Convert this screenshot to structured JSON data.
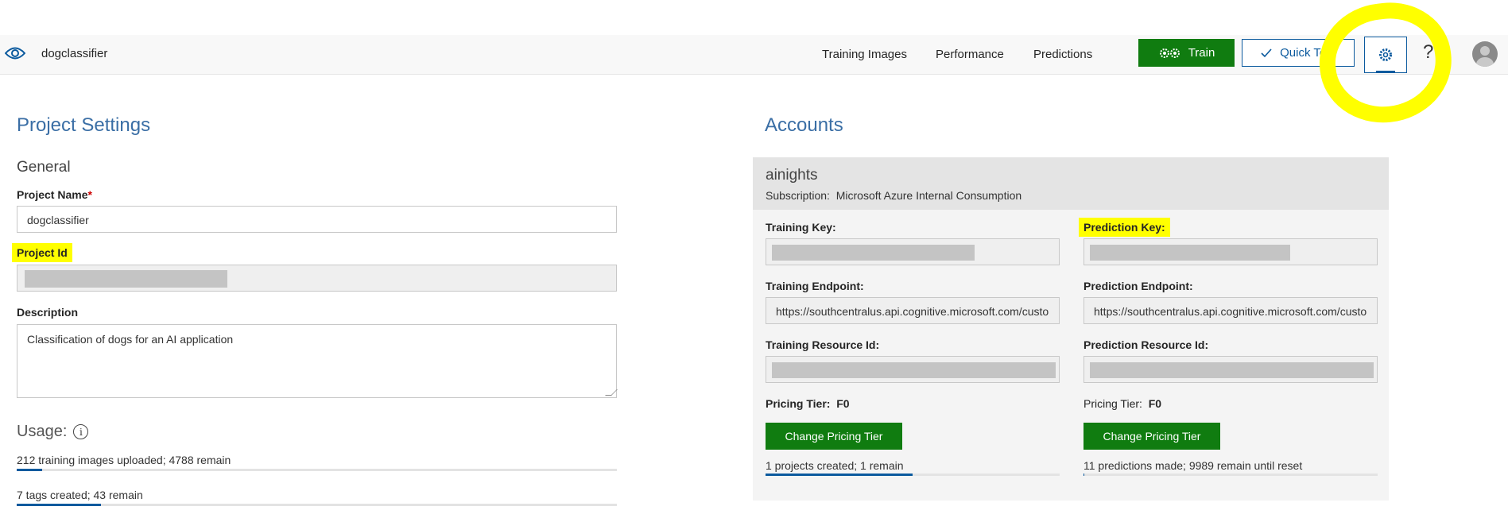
{
  "header": {
    "app_name": "dogclassifier",
    "nav": [
      "Training Images",
      "Performance",
      "Predictions"
    ],
    "train_label": "Train",
    "quick_test_label": "Quick Test",
    "help_glyph": "?"
  },
  "settings": {
    "title": "Project Settings",
    "general_title": "General",
    "project_name_label": "Project Name",
    "required_marker": "*",
    "project_name_value": "dogclassifier",
    "project_id_label": "Project Id",
    "description_label": "Description",
    "description_value": "Classification of dogs for an AI application",
    "usage_title": "Usage:",
    "usage": [
      {
        "text": "212 training images uploaded; 4788 remain",
        "progress": 0.042
      },
      {
        "text": "7 tags created; 43 remain",
        "progress": 0.14
      }
    ]
  },
  "accounts": {
    "title": "Accounts",
    "account_name": "ainights",
    "subscription_label": "Subscription:",
    "subscription_value": "Microsoft Azure Internal Consumption",
    "training_key_label": "Training Key:",
    "prediction_key_label": "Prediction Key:",
    "training_endpoint_label": "Training Endpoint:",
    "prediction_endpoint_label": "Prediction Endpoint:",
    "training_endpoint_value": "https://southcentralus.api.cognitive.microsoft.com/custo",
    "prediction_endpoint_value": "https://southcentralus.api.cognitive.microsoft.com/custo",
    "training_resource_label": "Training Resource Id:",
    "prediction_resource_label": "Prediction Resource Id:",
    "pricing_tier_label": "Pricing Tier:",
    "training_pricing_tier": "F0",
    "prediction_pricing_tier": "F0",
    "change_tier_label": "Change Pricing Tier",
    "training_usage": {
      "text": "1 projects created; 1 remain",
      "progress": 0.5
    },
    "prediction_usage": {
      "text": "11 predictions made; 9989 remain until reset",
      "progress": 0.0011
    }
  },
  "colors": {
    "accent": "#0b5a9e",
    "primary_button": "#107c10",
    "annotation": "#ffff00"
  },
  "icons": [
    "eye-icon",
    "gears-icon",
    "checkmark-icon",
    "gear-icon",
    "help-icon",
    "avatar-icon",
    "info-icon"
  ]
}
